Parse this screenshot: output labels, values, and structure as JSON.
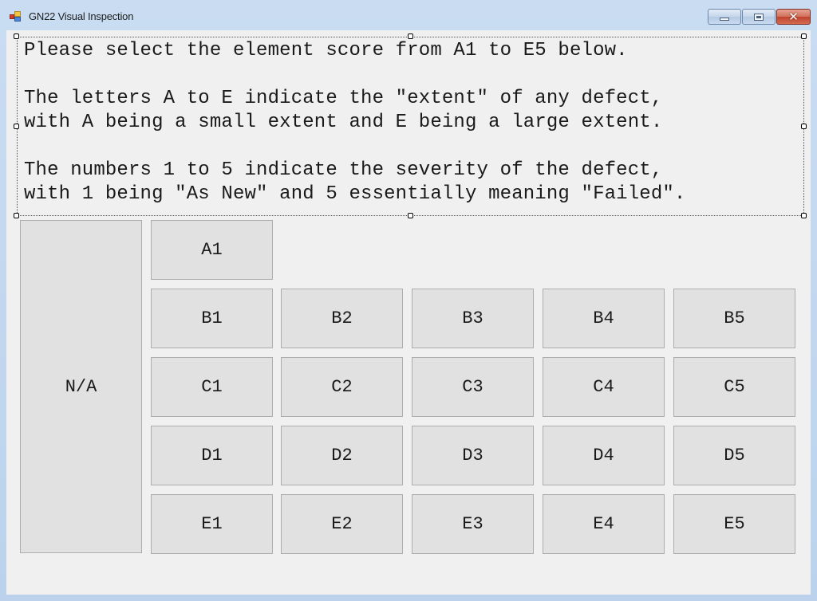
{
  "window": {
    "title": "GN22 Visual Inspection",
    "controls": {
      "minimize": "minimize",
      "maximize": "maximize",
      "close": "close"
    }
  },
  "instructions": {
    "lines": [
      "Please select the element score from A1 to E5 below.",
      "",
      "The letters A to E indicate the \"extent\" of any defect,",
      "with A being a small extent and E being a large extent.",
      "",
      "The numbers 1 to 5 indicate the severity of the defect,",
      "with 1 being \"As New\" and 5 essentially meaning \"Failed\"."
    ]
  },
  "scores": {
    "na_label": "N/A",
    "rows": [
      [
        "A1"
      ],
      [
        "B1",
        "B2",
        "B3",
        "B4",
        "B5"
      ],
      [
        "C1",
        "C2",
        "C3",
        "C4",
        "C5"
      ],
      [
        "D1",
        "D2",
        "D3",
        "D4",
        "D5"
      ],
      [
        "E1",
        "E2",
        "E3",
        "E4",
        "E5"
      ]
    ]
  }
}
